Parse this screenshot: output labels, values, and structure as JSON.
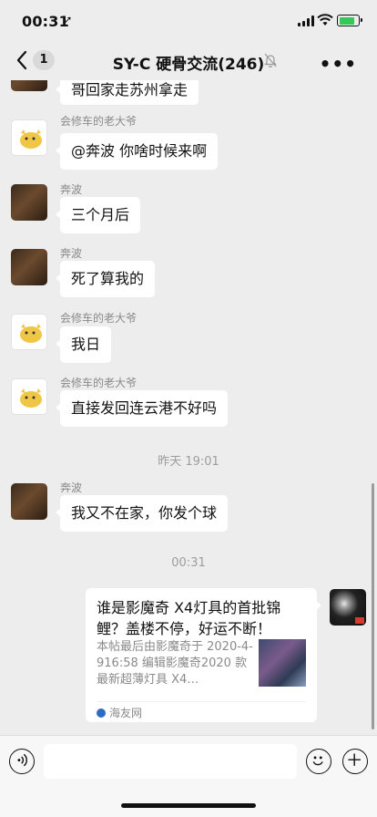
{
  "status": {
    "time": "00:31",
    "location_glyph": "➚"
  },
  "nav": {
    "badge": "1",
    "title": "SY-C  硬骨交流(246)",
    "more": "•••"
  },
  "messages": [
    {
      "text": "哥回家走苏州拿走"
    },
    {
      "sender": "会修车的老大爷",
      "text": "@奔波 你啥时候来啊"
    },
    {
      "sender": "奔波",
      "text": "三个月后"
    },
    {
      "sender": "奔波",
      "text": "死了算我的"
    },
    {
      "sender": "会修车的老大爷",
      "text": "我日"
    },
    {
      "sender": "会修车的老大爷",
      "text": "直接发回连云港不好吗"
    },
    {
      "sender": "奔波",
      "text": "我又不在家，你发个球"
    }
  ],
  "timestamps": [
    "昨天 19:01",
    "00:31"
  ],
  "card": {
    "title": "谁是影魔奇 X4灯具的首批锦鲤？盖楼不停，好运不断！",
    "desc": "本帖最后由影魔奇于 2020-4-916:58 编辑影魔奇2020 款最新超薄灯具 X4…",
    "source": "海友网"
  },
  "colors": {
    "background": "#ededed",
    "bubble": "#ffffff",
    "battery": "#34c759"
  }
}
